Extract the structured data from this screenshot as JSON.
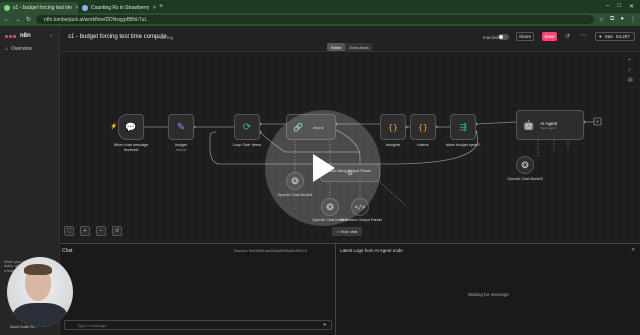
{
  "browser": {
    "tabs": [
      {
        "label": "s1 - budget forcing test tim",
        "active": true
      },
      {
        "label": "Counting Rs in Strawberry",
        "active": false
      }
    ],
    "url": "n8n.lumberjack.ai/workflow/DDNsqypBBhkTuL"
  },
  "sidebar": {
    "logo_text": "n8n",
    "items": [
      {
        "label": "Overview"
      }
    ],
    "promo_text": "Share your workflows with 40k+ users, unlock perks, and shine as a featured template creator!",
    "promo_button": "Become a creator"
  },
  "header": {
    "title": "s1 - budget forcing test time compute",
    "add_tag": "+ Add tag",
    "status_label": "Inactive",
    "share_label": "Share",
    "save_label": "Save",
    "star_label": "Star",
    "star_count": "54,297",
    "modes": [
      {
        "label": "Editor",
        "active": true
      },
      {
        "label": "Executions",
        "active": false
      }
    ]
  },
  "nodes": {
    "chat_trigger": "When chat message received",
    "budget": "budget",
    "budget_sub": "manual",
    "loop": "Loop Over Items",
    "chunk": "chunk",
    "thoughts": "thoughts",
    "tokens": "tokens",
    "token_budget": "token budget spent?",
    "agent": "AI Agent",
    "agent_sub": "Tools Agent",
    "openai_1": "OpenAI Chat Model1",
    "openai_2": "OpenAI Chat Model2",
    "auto_parser": "Auto-fixing Output Parser",
    "structured_parser": "Structured Output Parser",
    "openai_agent": "OpenAI Chat Model3"
  },
  "canvas": {
    "hide_chat": "Hide chat"
  },
  "chat": {
    "title": "Chat",
    "session": "Session: 9eb490e1aa4403dd9626b51d0917d",
    "input_placeholder": "Type a message"
  },
  "logs": {
    "title": "Latest Logs from AI Agent node",
    "waiting": "Waiting for message"
  },
  "webcam": {
    "name": "David Gobin St..."
  },
  "colors": {
    "accent": "#ea4b71",
    "trigger_icon": "#ffffff",
    "green_icon": "#3fb27f",
    "purple_icon": "#7b61ff"
  }
}
